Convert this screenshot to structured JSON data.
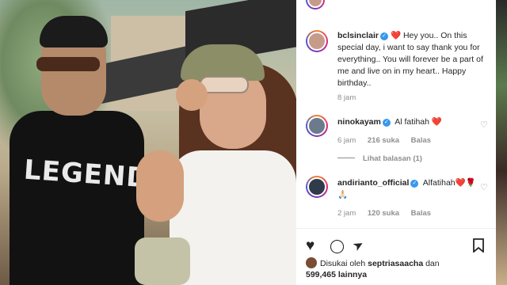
{
  "photo": {
    "shirt_text": "LEGEND"
  },
  "caption": {
    "username": "bclsinclair",
    "text": "Hey you.. On this special day, i want to say thank you for everything.. You will forever be a part of me and live on in my heart.. Happy birthday..",
    "time": "8 jam"
  },
  "comments": [
    {
      "username": "ninokayam",
      "text": "Al fatihah",
      "time": "6 jam",
      "likes": "216 suka",
      "reply": "Balas"
    },
    {
      "username": "andirianto_official",
      "text": "Alfatihah",
      "emoji_line": "🙏🏻",
      "time": "2 jam",
      "likes": "120 suka",
      "reply": "Balas"
    }
  ],
  "view_replies": "Lihat balasan (1)",
  "actions": {
    "like": "♥",
    "comment": "◯",
    "share": "➤",
    "save": "🔖"
  },
  "liked_by": {
    "prefix": "Disukai oleh",
    "user": "septriasaacha",
    "and": "dan",
    "count": "599,465",
    "suffix": "lainnya"
  },
  "colors": {
    "accent_blue": "#3897f0",
    "heart_red": "#ed4956",
    "meta_gray": "#8e8e8e"
  }
}
